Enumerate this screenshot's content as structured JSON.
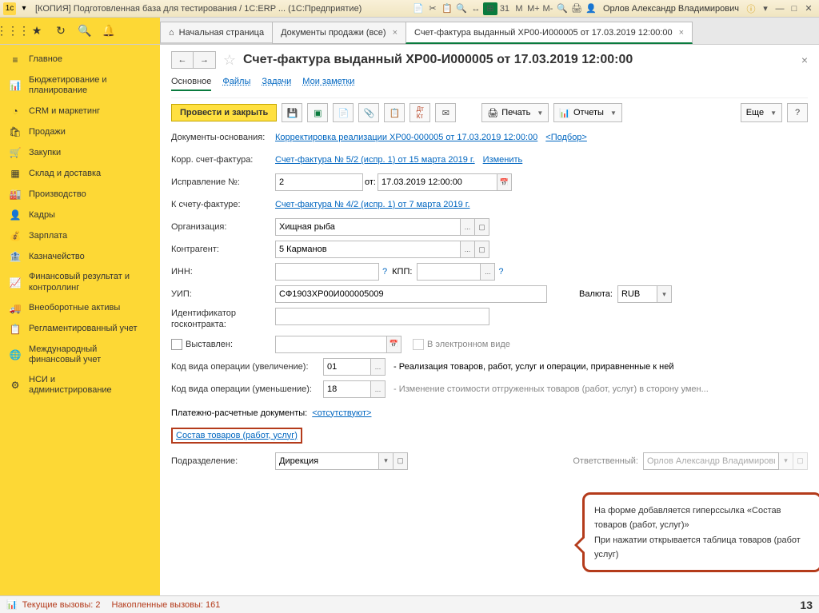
{
  "titlebar": {
    "title": "[КОПИЯ] Подготовленная база для тестирования / 1С:ERP ... (1С:Предприятие)",
    "user": "Орлов Александр Владимирович",
    "icons_right": [
      "M",
      "M+",
      "M-"
    ]
  },
  "toptabs": {
    "home": "Начальная страница",
    "tab1": "Документы продажи (все)",
    "tab2": "Счет-фактура выданный ХР00-И000005 от 17.03.2019 12:00:00"
  },
  "sidebar": {
    "items": [
      {
        "label": "Главное"
      },
      {
        "label": "Бюджетирование и\nпланирование"
      },
      {
        "label": "CRM и маркетинг"
      },
      {
        "label": "Продажи"
      },
      {
        "label": "Закупки"
      },
      {
        "label": "Склад и доставка"
      },
      {
        "label": "Производство"
      },
      {
        "label": "Кадры"
      },
      {
        "label": "Зарплата"
      },
      {
        "label": "Казначейство"
      },
      {
        "label": "Финансовый результат и\nконтроллинг"
      },
      {
        "label": "Внеоборотные активы"
      },
      {
        "label": "Регламентированный учет"
      },
      {
        "label": "Международный\nфинансовый учет"
      },
      {
        "label": "НСИ и\nадминистрирование"
      }
    ]
  },
  "doc": {
    "title": "Счет-фактура выданный ХР00-И000005 от 17.03.2019 12:00:00",
    "subtabs": {
      "main": "Основное",
      "files": "Файлы",
      "tasks": "Задачи",
      "notes": "Мои заметки"
    },
    "cmdbar": {
      "post_close": "Провести и закрыть",
      "print": "Печать",
      "reports": "Отчеты",
      "more": "Еще"
    },
    "fields": {
      "basis_label": "Документы-основания:",
      "basis_link": "Корректировка реализации ХР00-000005 от 17.03.2019 12:00:00",
      "basis_pick": "<Подбор>",
      "corr_label": "Корр. счет-фактура:",
      "corr_link": "Счет-фактура № 5/2 (испр. 1) от 15 марта 2019 г.",
      "change": "Изменить",
      "fix_label": "Исправление №:",
      "fix_value": "2",
      "from": "от:",
      "fix_date": "17.03.2019 12:00:00",
      "to_invoice_label": "К счету-фактуре:",
      "to_invoice_link": "Счет-фактура № 4/2 (испр. 1) от 7 марта 2019 г.",
      "org_label": "Организация:",
      "org_value": "Хищная рыба",
      "partner_label": "Контрагент:",
      "partner_value": "5 Карманов",
      "inn_label": "ИНН:",
      "kpp_label": "КПП:",
      "uip_label": "УИП:",
      "uip_value": "СФ1903ХР00И000005009",
      "currency_label": "Валюта:",
      "currency_value": "RUB",
      "gk_label": "Идентификатор госконтракта:",
      "issued": "Выставлен:",
      "electronic": "В электронном виде",
      "opcode_inc_label": "Код вида операции (увеличение):",
      "opcode_inc_value": "01",
      "opcode_inc_desc": "- Реализация товаров, работ, услуг и операции, приравненные к ней",
      "opcode_dec_label": "Код вида операции (уменьшение):",
      "opcode_dec_value": "18",
      "opcode_dec_desc": "- Изменение стоимости отгруженных товаров (работ, услуг) в сторону умен...",
      "paydocs_label": "Платежно-расчетные документы:",
      "paydocs_link": "<отсутствуют>",
      "goods_link": "Состав товаров (работ, услуг)",
      "dept_label": "Подразделение:",
      "dept_value": "Дирекция",
      "resp_label": "Ответственный:",
      "resp_value": "Орлов Александр Владимирович"
    }
  },
  "callout": {
    "text": "На форме добавляется гиперссылка «Состав товаров (работ, услуг)»\nПри нажатии открывается таблица товаров (работ услуг)"
  },
  "statusbar": {
    "calls": "Текущие вызовы: 2",
    "accum": "Накопленные вызовы: 161",
    "page": "13"
  }
}
